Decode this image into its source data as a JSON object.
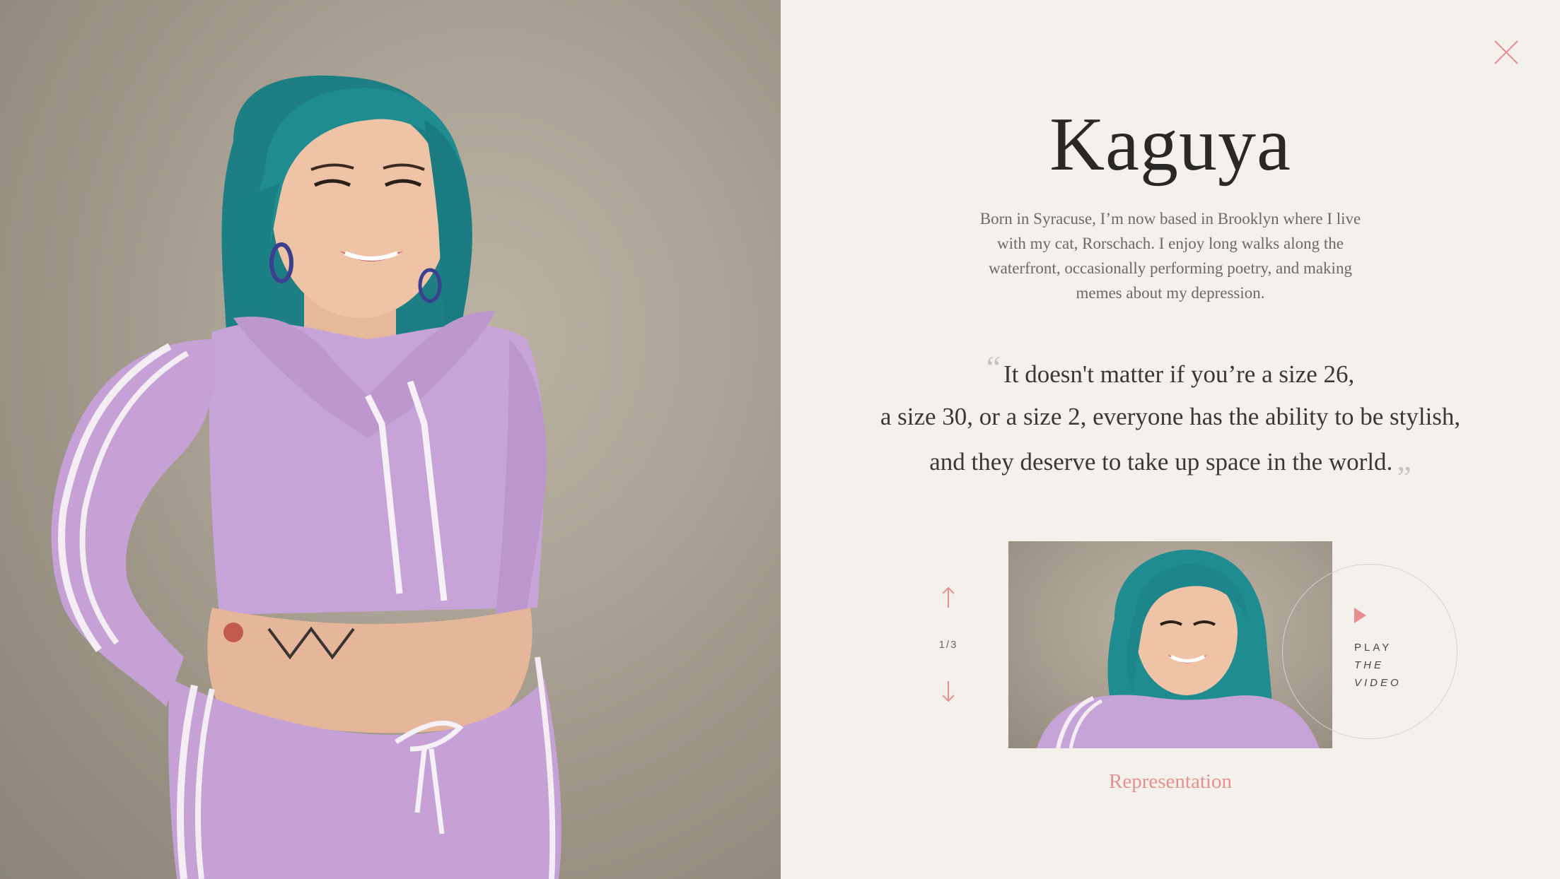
{
  "profile": {
    "name": "Kaguya",
    "bio": "Born in Syracuse, I’m now based in Brooklyn where I live with my cat, Rorschach. I enjoy long walks along the waterfront, occasionally performing poetry, and making memes about my depression.",
    "quote_lines": [
      "It doesn't matter if you’re a size 26,",
      "a size 30, or a size 2, everyone has the ability to be stylish,",
      "and they deserve to take up space in the world."
    ],
    "quote_open": "“",
    "quote_close": "”"
  },
  "slider": {
    "counter": "1/3",
    "play_label": [
      "PLAY",
      "THE",
      "VIDEO"
    ],
    "caption": "Representation"
  },
  "icons": {
    "close": "close-icon",
    "arrow_up": "arrow-up-icon",
    "arrow_down": "arrow-down-icon",
    "play": "play-icon"
  },
  "colors": {
    "background": "#f4f1ed",
    "accent": "#e98d90",
    "caption": "#e5908f",
    "hair": "#1f8c8f",
    "outfit": "#c9a6d8"
  }
}
